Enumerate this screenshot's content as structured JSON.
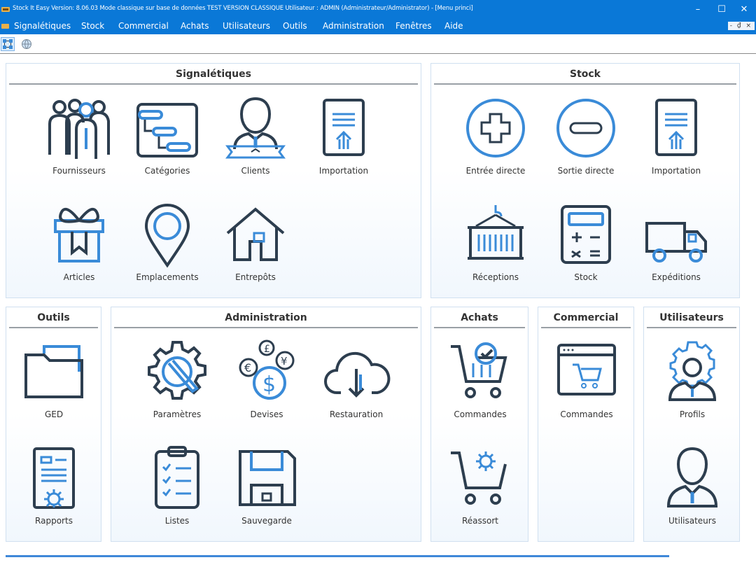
{
  "window": {
    "title": "Stock It Easy Version: 8.06.03  Mode  classique sur base de données TEST VERSION CLASSIQUE Utilisateur : ADMIN (Administrateur/Administrator) - [Menu princi]",
    "controls": {
      "minimize": "–",
      "maximize": "☐",
      "close": "✕"
    }
  },
  "menubar": {
    "items": [
      "Signalétiques",
      "Stock",
      "Commercial",
      "Achats",
      "Utilisateurs",
      "Outils",
      "Administration",
      "Fenêtres",
      "Aide"
    ],
    "mdi_controls": "- ₫ ×"
  },
  "toolbar": {
    "buttons": [
      "grid-icon",
      "globe-icon"
    ]
  },
  "colors": {
    "accent": "#0a78d7",
    "icon_dark": "#2d3e4f",
    "icon_blue": "#3a8bd8"
  },
  "panels": {
    "signaletiques": {
      "title": "Signalétiques",
      "tiles": [
        {
          "label": "Fournisseurs",
          "icon": "suppliers-group-icon"
        },
        {
          "label": "Catégories",
          "icon": "categories-flow-icon"
        },
        {
          "label": "Clients",
          "icon": "client-person-icon"
        },
        {
          "label": "Importation",
          "icon": "import-document-icon"
        },
        {
          "label": "Articles",
          "icon": "gift-box-icon"
        },
        {
          "label": "Emplacements",
          "icon": "location-pin-icon"
        },
        {
          "label": "Entrepôts",
          "icon": "warehouse-house-icon"
        }
      ]
    },
    "stock": {
      "title": "Stock",
      "tiles": [
        {
          "label": "Entrée directe",
          "icon": "plus-circle-icon"
        },
        {
          "label": "Sortie directe",
          "icon": "minus-circle-icon"
        },
        {
          "label": "Importation",
          "icon": "import-document-icon"
        },
        {
          "label": "Réceptions",
          "icon": "container-crane-icon"
        },
        {
          "label": "Stock",
          "icon": "calculator-icon"
        },
        {
          "label": "Expéditions",
          "icon": "truck-icon"
        }
      ]
    },
    "outils": {
      "title": "Outils",
      "tiles": [
        {
          "label": "GED",
          "icon": "folder-icon"
        },
        {
          "label": "Rapports",
          "icon": "report-gear-icon"
        }
      ]
    },
    "administration": {
      "title": "Administration",
      "tiles": [
        {
          "label": "Paramètres",
          "icon": "gear-wrench-icon"
        },
        {
          "label": "Devises",
          "icon": "currency-coins-icon"
        },
        {
          "label": "Restauration",
          "icon": "cloud-download-icon"
        },
        {
          "label": "Listes",
          "icon": "clipboard-list-icon"
        },
        {
          "label": "Sauvegarde",
          "icon": "floppy-disk-icon"
        }
      ]
    },
    "achats": {
      "title": "Achats",
      "tiles": [
        {
          "label": "Commandes",
          "icon": "cart-check-icon"
        },
        {
          "label": "Réassort",
          "icon": "cart-gear-icon"
        }
      ]
    },
    "commercial": {
      "title": "Commercial",
      "tiles": [
        {
          "label": "Commandes",
          "icon": "web-cart-icon"
        }
      ]
    },
    "utilisateurs": {
      "title": "Utilisateurs",
      "tiles": [
        {
          "label": "Profils",
          "icon": "user-gear-icon"
        },
        {
          "label": "Utilisateurs",
          "icon": "user-icon"
        }
      ]
    }
  }
}
